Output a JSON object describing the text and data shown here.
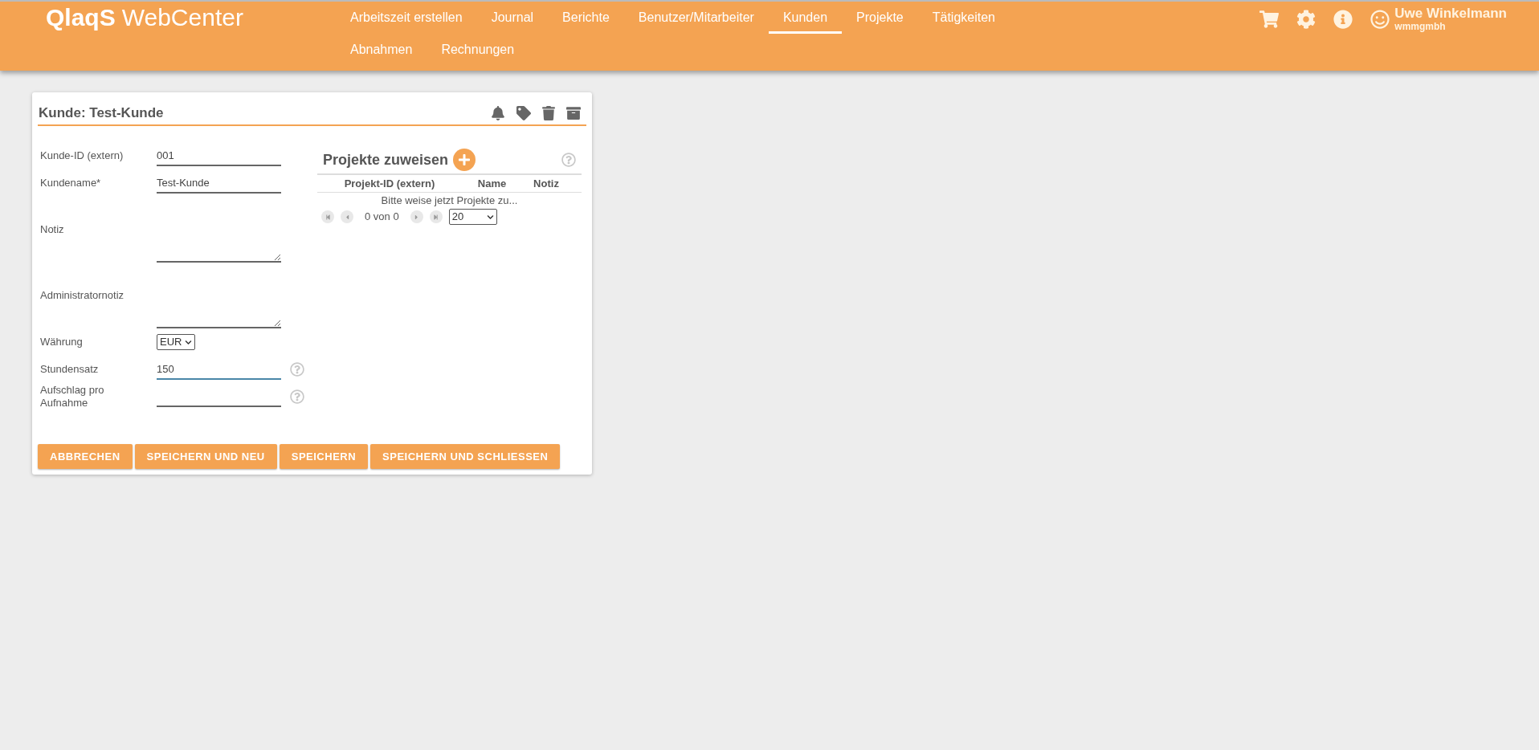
{
  "header": {
    "logo": "QlaqS",
    "app_name": "WebCenter",
    "nav": [
      {
        "label": "Arbeitszeit erstellen",
        "selected": false
      },
      {
        "label": "Journal",
        "selected": false
      },
      {
        "label": "Berichte",
        "selected": false
      },
      {
        "label": "Benutzer/Mitarbeiter",
        "selected": false
      },
      {
        "label": "Kunden",
        "selected": true
      },
      {
        "label": "Projekte",
        "selected": false
      },
      {
        "label": "Tätigkeiten",
        "selected": false
      },
      {
        "label": "Abnahmen",
        "selected": false
      },
      {
        "label": "Rechnungen",
        "selected": false
      }
    ],
    "user": {
      "name": "Uwe Winkelmann",
      "company": "wmmgmbh"
    }
  },
  "card": {
    "title": "Kunde: Test-Kunde",
    "fields": [
      {
        "kind": "text",
        "label": "Kunde-ID (extern)",
        "value": "001",
        "focused": false,
        "help": false
      },
      {
        "kind": "text",
        "label": "Kundename*",
        "value": "Test-Kunde",
        "focused": false,
        "help": false
      },
      {
        "kind": "textarea",
        "label": "Notiz",
        "focused": false,
        "help": false
      },
      {
        "kind": "textarea",
        "label": "Administratornotiz",
        "focused": false,
        "help": false
      },
      {
        "kind": "select",
        "label": "Währung",
        "value": "EUR",
        "focused": false,
        "help": false
      },
      {
        "kind": "text",
        "label": "Stundensatz",
        "value": "150",
        "focused": true,
        "help": true
      },
      {
        "kind": "text",
        "label": "Aufschlag pro Aufnahme",
        "focused": false,
        "help": true
      }
    ],
    "projects": {
      "title": "Projekte zuweisen",
      "columns": [
        "Projekt-ID (extern)",
        "Name",
        "Notiz"
      ],
      "empty_message": "Bitte weise jetzt Projekte zu...",
      "page_info": "0 von 0",
      "page_size": "20"
    },
    "buttons": [
      "ABBRECHEN",
      "SPEICHERN UND NEU",
      "SPEICHERN",
      "SPEICHERN UND SCHLIESSEN"
    ]
  }
}
